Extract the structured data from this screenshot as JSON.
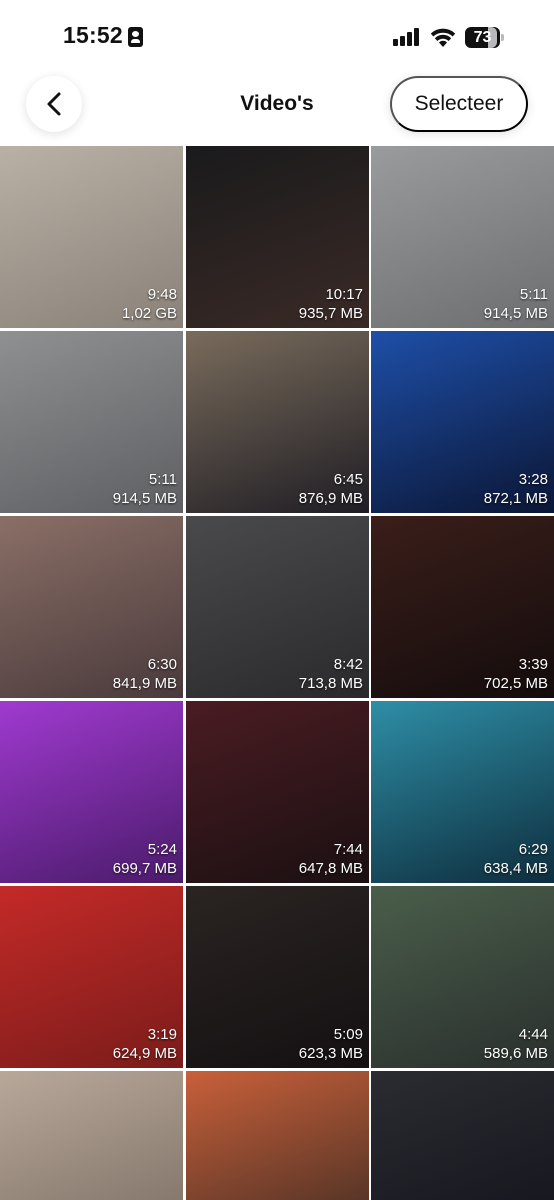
{
  "status_bar": {
    "time": "15:52",
    "battery_level": "73",
    "battery_fraction": 0.73
  },
  "nav": {
    "title": "Video's",
    "select_label": "Selecteer",
    "back_icon": "chevron-left-icon"
  },
  "videos": [
    {
      "duration": "9:48",
      "size": "1,02 GB",
      "bg": [
        "#b9b1a6",
        "#8a8178"
      ]
    },
    {
      "duration": "10:17",
      "size": "935,7 MB",
      "bg": [
        "#1a1a1c",
        "#3a2a26"
      ]
    },
    {
      "duration": "5:11",
      "size": "914,5 MB",
      "bg": [
        "#9a9b9d",
        "#6d6e70"
      ]
    },
    {
      "duration": "5:11",
      "size": "914,5 MB",
      "bg": [
        "#8f9092",
        "#5d5f62"
      ]
    },
    {
      "duration": "6:45",
      "size": "876,9 MB",
      "bg": [
        "#7a6c5c",
        "#1f1d24"
      ]
    },
    {
      "duration": "3:28",
      "size": "872,1 MB",
      "bg": [
        "#1e4fa8",
        "#0b1635"
      ]
    },
    {
      "duration": "6:30",
      "size": "841,9 MB",
      "bg": [
        "#8a6f66",
        "#4a3a3c"
      ]
    },
    {
      "duration": "8:42",
      "size": "713,8 MB",
      "bg": [
        "#4a4a4c",
        "#2a2a2c"
      ]
    },
    {
      "duration": "3:39",
      "size": "702,5 MB",
      "bg": [
        "#3a1e1a",
        "#140c0c"
      ]
    },
    {
      "duration": "5:24",
      "size": "699,7 MB",
      "bg": [
        "#a03ad0",
        "#4a1b6a"
      ]
    },
    {
      "duration": "7:44",
      "size": "647,8 MB",
      "bg": [
        "#4a1c22",
        "#1a1012"
      ]
    },
    {
      "duration": "6:29",
      "size": "638,4 MB",
      "bg": [
        "#2e8ea6",
        "#0e2e3e"
      ]
    },
    {
      "duration": "3:19",
      "size": "624,9 MB",
      "bg": [
        "#c42a28",
        "#7a1c1a"
      ]
    },
    {
      "duration": "5:09",
      "size": "623,3 MB",
      "bg": [
        "#2a2422",
        "#141012"
      ]
    },
    {
      "duration": "4:44",
      "size": "589,6 MB",
      "bg": [
        "#4a5e4a",
        "#2a302e"
      ]
    },
    {
      "duration": "",
      "size": "",
      "bg": [
        "#b8a89a",
        "#7a6c62"
      ]
    },
    {
      "duration": "",
      "size": "",
      "bg": [
        "#c9603a",
        "#3a2a22"
      ]
    },
    {
      "duration": "",
      "size": "",
      "bg": [
        "#2a2c32",
        "#12131a"
      ]
    }
  ]
}
